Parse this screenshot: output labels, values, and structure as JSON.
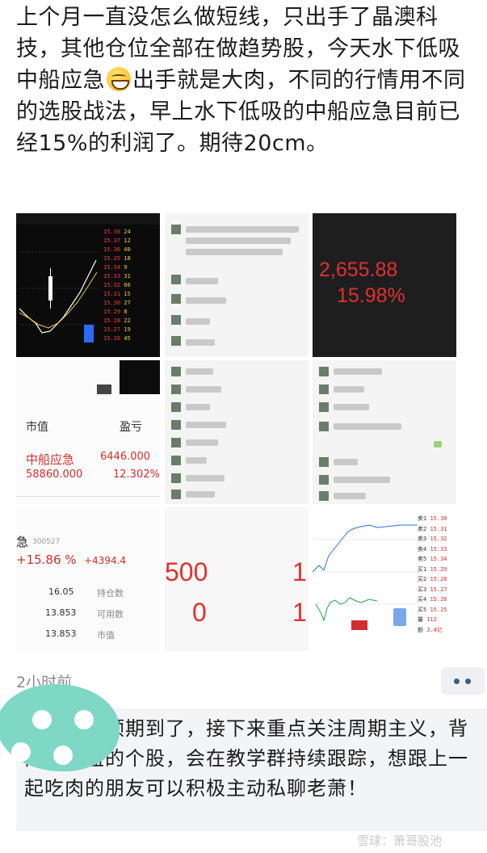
{
  "post": {
    "text_before_emoji": "上个月一直没怎么做短线，只出手了晶澳科技，其他仓位全部在做趋势股，今天水下低吸中船应急",
    "emoji": "grinning-face",
    "text_after_emoji": "出手就是大肉，不同的行情用不同的选股战法，早上水下低吸的中船应急目前已经15%的利润了。期待20cm。"
  },
  "images": {
    "big_number": {
      "value": "2,655.88",
      "percent": "15.98%"
    },
    "portfolio": {
      "col_market_value": "市值",
      "col_profit": "盈亏",
      "stock_name": "中船应急",
      "profit_amount": "6446.000",
      "market_value": "58860.000",
      "profit_percent": "12.302%"
    },
    "position_detail": {
      "name_fragment": "急",
      "code": "300527",
      "percent": "+15.86 %",
      "amount": "+4394.4",
      "rows": [
        {
          "value": "16.05",
          "label": "持仓数"
        },
        {
          "value": "13.853",
          "label": "可用数"
        },
        {
          "value": "13.853",
          "label": "市值"
        }
      ]
    },
    "red_numbers": {
      "a": "500",
      "b": "1",
      "c": "0",
      "d": "1"
    }
  },
  "meta": {
    "timestamp": "2小时前"
  },
  "comment": {
    "text": "反弹我们预期到了，接下来重点关注周期主义，背离高控盘的个股，会在教学群持续跟踪，想跟上一起吃肉的朋友可以积极主动私聊老萧！"
  },
  "watermark": "雪球：萧哥股池",
  "colors": {
    "accent_red": "#e03131",
    "avatar_teal": "#7fd7c6",
    "menu_dots": "#3c5a8a"
  }
}
